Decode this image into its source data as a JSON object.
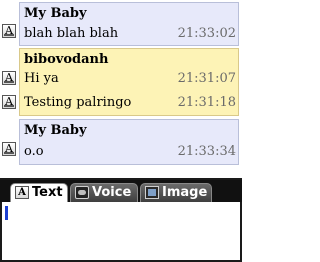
{
  "messages": [
    {
      "sender": "My Baby",
      "lines": [
        {
          "text": "blah blah blah",
          "time": "21:33:02"
        }
      ]
    },
    {
      "sender": "bibovodanh",
      "lines": [
        {
          "text": "Hi ya",
          "time": "21:31:07"
        },
        {
          "text": "Testing palringo",
          "time": "21:31:18"
        }
      ]
    },
    {
      "sender": "My Baby",
      "lines": [
        {
          "text": "o.o",
          "time": "21:33:34"
        }
      ]
    }
  ],
  "tabs": [
    {
      "label": "Text",
      "icon": "text-a-icon",
      "active": true
    },
    {
      "label": "Voice",
      "icon": "voice-icon",
      "active": false
    },
    {
      "label": "Image",
      "icon": "image-icon",
      "active": false
    }
  ],
  "message_icon_glyph": "A",
  "input": {
    "value": ""
  },
  "colors": {
    "incoming_bg": "#e7e9fa",
    "outgoing_bg": "#fdf3b6",
    "tab_bar": "#111111",
    "caret": "#1c3fd1"
  }
}
